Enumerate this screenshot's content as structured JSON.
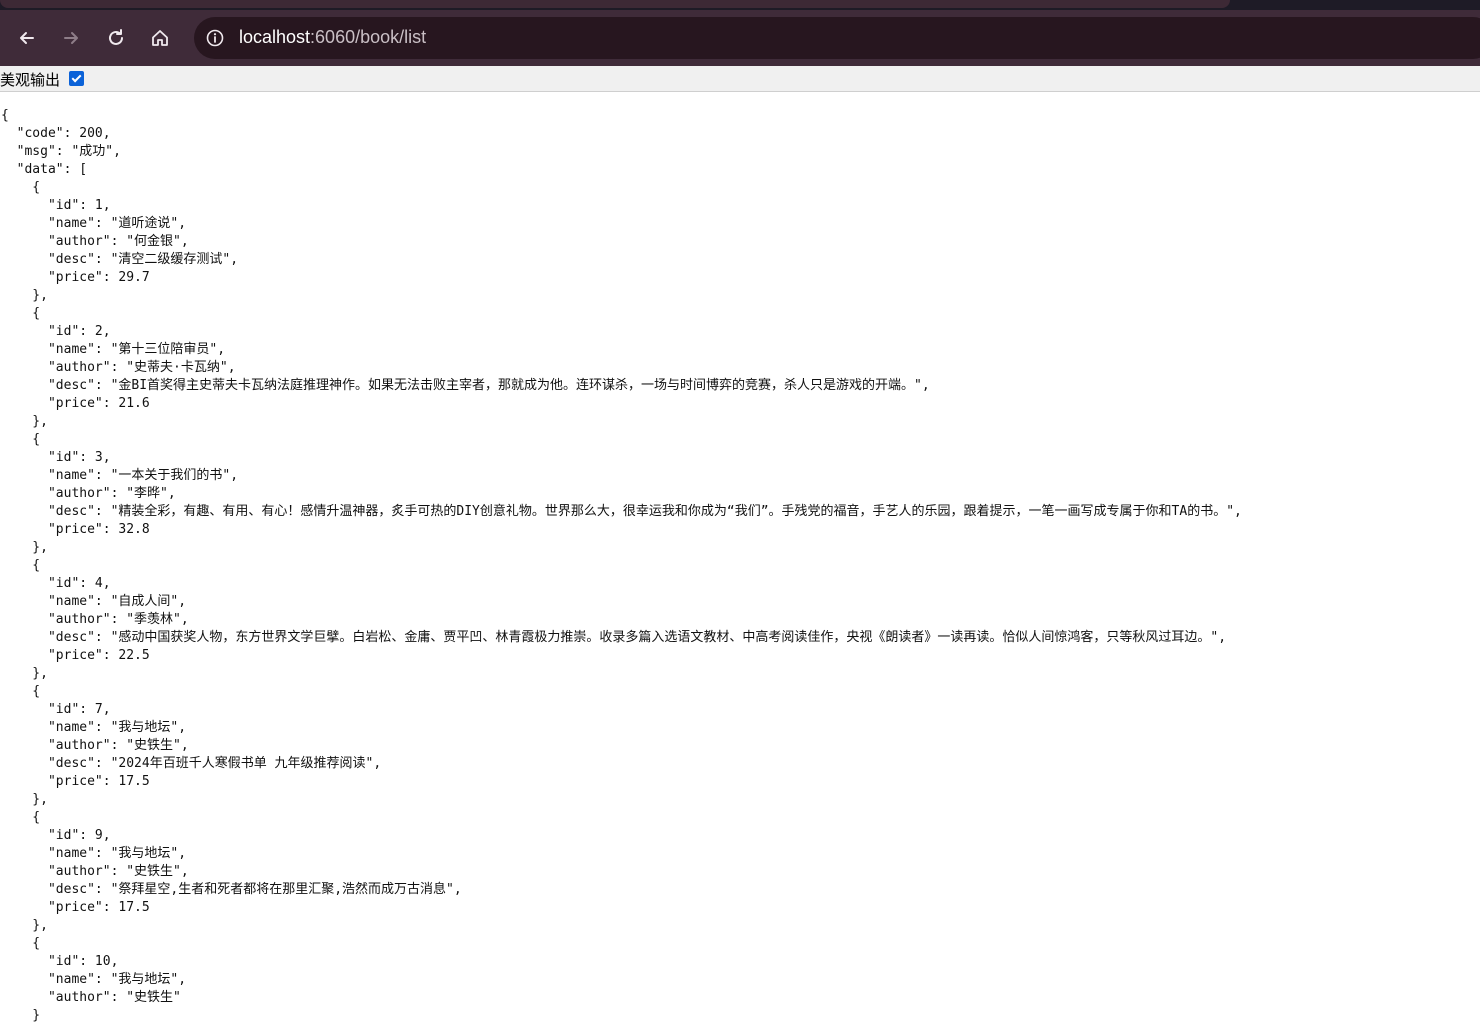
{
  "browser": {
    "url_host": "localhost",
    "url_rest": ":6060/book/list",
    "back_icon": "arrow-left-icon",
    "forward_icon": "arrow-right-icon",
    "reload_icon": "reload-icon",
    "home_icon": "home-icon",
    "site_info_icon": "info-circle-icon"
  },
  "page": {
    "pretty_label": "美观输出",
    "pretty_checked": true
  },
  "response": {
    "code": 200,
    "msg": "成功",
    "data": [
      {
        "id": 1,
        "name": "道听途说",
        "author": "何金银",
        "desc": "清空二级缓存测试",
        "price": 29.7
      },
      {
        "id": 2,
        "name": "第十三位陪审员",
        "author": "史蒂夫·卡瓦纳",
        "desc": "金BI首奖得主史蒂夫卡瓦纳法庭推理神作。如果无法击败主宰者，那就成为他。连环谋杀，一场与时间博弈的竞赛，杀人只是游戏的开端。",
        "price": 21.6
      },
      {
        "id": 3,
        "name": "一本关于我们的书",
        "author": "李晔",
        "desc": "精装全彩，有趣、有用、有心！感情升温神器，炙手可热的DIY创意礼物。世界那么大，很幸运我和你成为“我们”。手残党的福音，手艺人的乐园，跟着提示，一笔一画写成专属于你和TA的书。",
        "price": 32.8
      },
      {
        "id": 4,
        "name": "自成人间",
        "author": "季羡林",
        "desc": "感动中国获奖人物，东方世界文学巨擘。白岩松、金庸、贾平凹、林青霞极力推崇。收录多篇入选语文教材、中高考阅读佳作，央视《朗读者》一读再读。恰似人间惊鸿客，只等秋风过耳边。",
        "price": 22.5
      },
      {
        "id": 7,
        "name": "我与地坛",
        "author": "史铁生",
        "desc": "2024年百班千人寒假书单 九年级推荐阅读",
        "price": 17.5
      },
      {
        "id": 9,
        "name": "我与地坛",
        "author": "史铁生",
        "desc": "祭拜星空,生者和死者都将在那里汇聚,浩然而成万古消息",
        "price": 17.5
      },
      {
        "id": 10,
        "name": "我与地坛",
        "author": "史铁生"
      }
    ]
  }
}
